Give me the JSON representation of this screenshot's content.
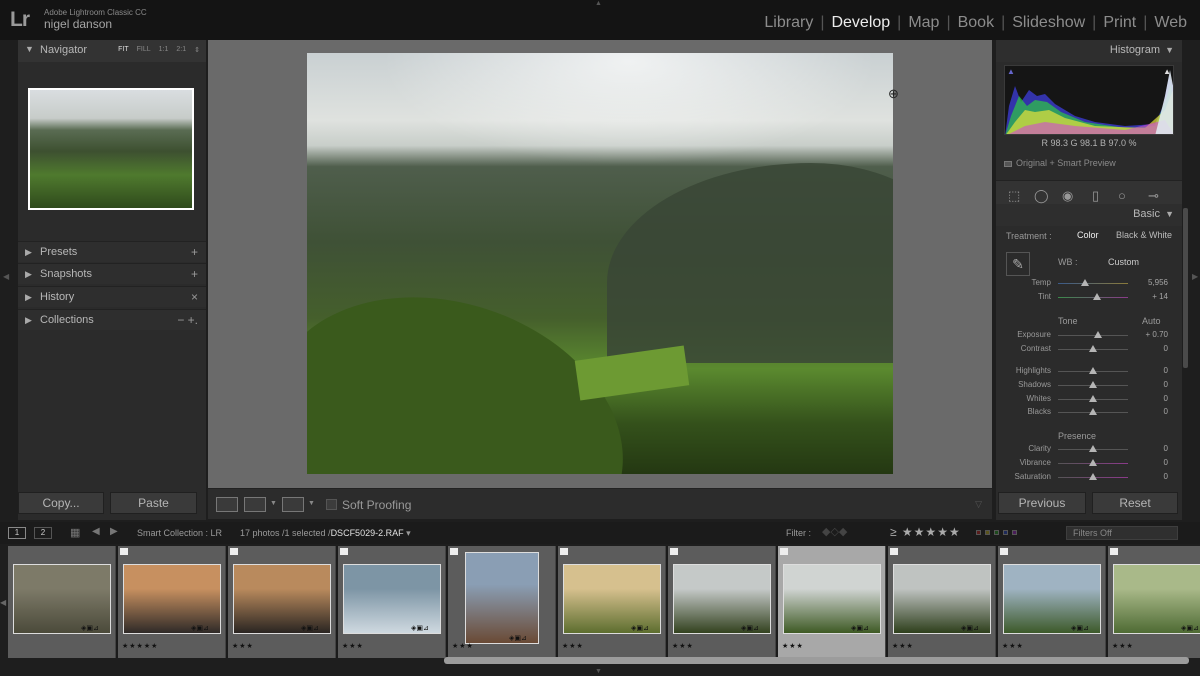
{
  "app": {
    "logo": "Lr",
    "name": "Adobe Lightroom Classic CC",
    "user": "nigel danson",
    "modules": [
      "Library",
      "Develop",
      "Map",
      "Book",
      "Slideshow",
      "Print",
      "Web"
    ],
    "active_module": "Develop"
  },
  "left_panel": {
    "navigator": {
      "title": "Navigator",
      "zoom_options": [
        "FIT",
        "FILL",
        "1:1",
        "2:1"
      ],
      "zoom_selected": "FIT"
    },
    "sections": [
      {
        "label": "Presets",
        "action": "+"
      },
      {
        "label": "Snapshots",
        "action": "+"
      },
      {
        "label": "History",
        "action": "×"
      },
      {
        "label": "Collections",
        "action": "− +."
      }
    ],
    "copy_label": "Copy...",
    "paste_label": "Paste"
  },
  "toolbar": {
    "soft_proofing_label": "Soft Proofing"
  },
  "right_panel": {
    "histogram": {
      "title": "Histogram",
      "readout": "R 98.3  G 98.1  B 97.0 %",
      "preview_label": "Original + Smart Preview"
    },
    "basic": {
      "title": "Basic",
      "treatment_label": "Treatment :",
      "treatment_options": [
        "Color",
        "Black & White"
      ],
      "treatment_selected": "Color",
      "wb_label": "WB :",
      "wb_value": "Custom",
      "tone_label": "Tone",
      "auto_label": "Auto",
      "presence_label": "Presence",
      "sliders": [
        {
          "label": "Temp",
          "value": "5,956",
          "pos": 0.38
        },
        {
          "label": "Tint",
          "value": "+ 14",
          "pos": 0.55
        },
        {
          "label": "Exposure",
          "value": "+ 0.70",
          "pos": 0.57
        },
        {
          "label": "Contrast",
          "value": "0",
          "pos": 0.5
        },
        {
          "label": "Highlights",
          "value": "0",
          "pos": 0.5
        },
        {
          "label": "Shadows",
          "value": "0",
          "pos": 0.5
        },
        {
          "label": "Whites",
          "value": "0",
          "pos": 0.5
        },
        {
          "label": "Blacks",
          "value": "0",
          "pos": 0.5
        },
        {
          "label": "Clarity",
          "value": "0",
          "pos": 0.5
        },
        {
          "label": "Vibrance",
          "value": "0",
          "pos": 0.5
        },
        {
          "label": "Saturation",
          "value": "0",
          "pos": 0.5
        }
      ]
    },
    "previous_label": "Previous",
    "reset_label": "Reset"
  },
  "filmstrip": {
    "page_1": "1",
    "page_2": "2",
    "source": "Smart Collection : LR",
    "count": "17 photos /1 selected /",
    "filename": "DSCF5029-2.RAF",
    "filter_label": "Filter :",
    "rating_filter": "≥ ★★★★★",
    "filters_off": "Filters Off",
    "thumbnails": [
      {
        "name": "forest-path",
        "stars": "",
        "colors": [
          "#7d7a68",
          "#4b4a3a"
        ]
      },
      {
        "name": "coast-sunset-1",
        "stars": "★★★★★",
        "colors": [
          "#c79060",
          "#2f2a28"
        ]
      },
      {
        "name": "coast-sunset-2",
        "stars": "★★★",
        "colors": [
          "#b98a5d",
          "#2a2522"
        ]
      },
      {
        "name": "sea-waves",
        "stars": "★★★",
        "colors": [
          "#7d95a5",
          "#cfd9e0"
        ]
      },
      {
        "name": "lighthouse",
        "stars": "★★★",
        "colors": [
          "#8a9eb4",
          "#6a4a35"
        ]
      },
      {
        "name": "fence-sunset",
        "stars": "★★★",
        "colors": [
          "#d6c08e",
          "#5d6e2f"
        ]
      },
      {
        "name": "valley-1",
        "stars": "★★★",
        "colors": [
          "#c5c9c8",
          "#33421f"
        ]
      },
      {
        "name": "valley-selected",
        "stars": "★★★",
        "colors": [
          "#d0d4d2",
          "#3e5a24"
        ]
      },
      {
        "name": "valley-2",
        "stars": "★★★",
        "colors": [
          "#bfc3c1",
          "#2e3f1c"
        ]
      },
      {
        "name": "sea-cliff",
        "stars": "★★★",
        "colors": [
          "#9fb3c2",
          "#3d5a2a"
        ]
      },
      {
        "name": "green-forest",
        "stars": "★★★",
        "colors": [
          "#a9b989",
          "#4f6b34"
        ]
      }
    ],
    "selected_index": 7
  },
  "colors": {
    "accent": "#ececec",
    "panel": "#2b2b2b",
    "background": "#1e1e1e"
  }
}
